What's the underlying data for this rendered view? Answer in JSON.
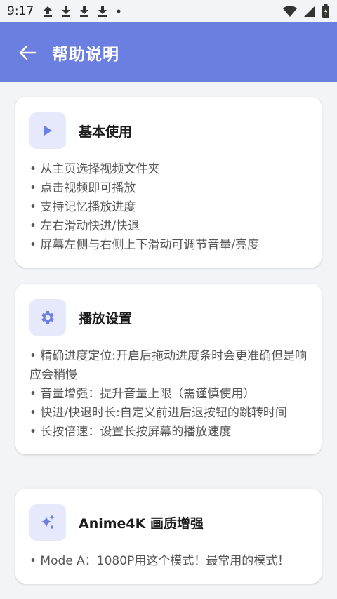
{
  "status_bar": {
    "time": "9:17",
    "notification_icons": [
      "upload-icon",
      "download-icon",
      "download-icon",
      "download-icon",
      "dot-icon"
    ],
    "system_icons": [
      "wifi-icon",
      "signal-icon",
      "battery-icon"
    ]
  },
  "app_bar": {
    "title": "帮助说明",
    "background_color": "#6a7fe0",
    "back_icon": "arrow-left-icon"
  },
  "sections": [
    {
      "icon": "play-icon",
      "title": "基本使用",
      "items": [
        "• 从主页选择视频文件夹",
        "• 点击视频即可播放",
        "• 支持记忆播放进度",
        "• 左右滑动快进/快退",
        "• 屏幕左侧与右侧上下滑动可调节音量/亮度"
      ]
    },
    {
      "icon": "gear-icon",
      "title": "播放设置",
      "items": [
        "• 精确进度定位:开启后拖动进度条时会更准确但是响应会稍慢",
        "• 音量增强：提升音量上限（需谨慎使用）",
        "• 快进/快退时长:自定义前进后退按钮的跳转时间",
        "• 长按倍速：设置长按屏幕的播放速度"
      ]
    },
    {
      "icon": "sparkle-icon",
      "title": "Anime4K 画质增强",
      "items": [
        "• Mode A：1080P用这个模式！最常用的模式！"
      ]
    }
  ],
  "colors": {
    "accent": "#6a7fe0",
    "icon_bg": "#e6e9fb",
    "page_bg": "#f3f4f8"
  }
}
